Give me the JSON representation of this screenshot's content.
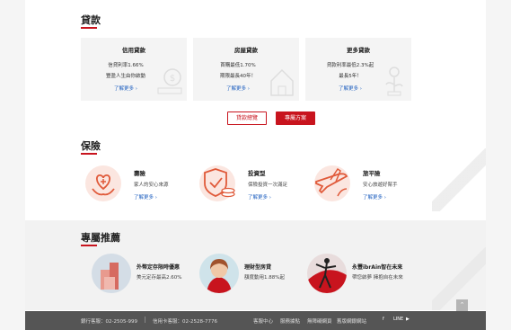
{
  "loan": {
    "title": "貸款",
    "cards": [
      {
        "title": "信用貸款",
        "line1": "信貸利率1.66%",
        "line2": "豐盈人生由你啟動",
        "more": "了解更多 ›"
      },
      {
        "title": "房屋貸款",
        "line1": "首購最低1.70%",
        "line2": "期限最長40年！",
        "more": "了解更多 ›"
      },
      {
        "title": "更多貸款",
        "line1": "貸款利率最低2.3%起",
        "line2": "最長5年！",
        "more": "了解更多 ›"
      }
    ],
    "btn_overview": "貸款總覽",
    "btn_exclusive": "專屬方案"
  },
  "insurance": {
    "title": "保險",
    "items": [
      {
        "title": "壽險",
        "sub": "家人的安心來源",
        "more": "了解更多 ›",
        "icon": "heart-hands-icon"
      },
      {
        "title": "投資型",
        "sub": "保險投資一次滿足",
        "more": "了解更多 ›",
        "icon": "shield-coins-icon"
      },
      {
        "title": "旅平險",
        "sub": "安心旅遊好幫手",
        "more": "了解更多 ›",
        "icon": "airplane-icon"
      }
    ]
  },
  "promo": {
    "title": "專屬推薦",
    "items": [
      {
        "title": "外幣定存限時優惠",
        "sub": "美元定存最高2.60%"
      },
      {
        "title": "理財型房貸",
        "sub": "額度動用1.88%起"
      },
      {
        "title": "永豐ibrAin智在未來",
        "sub": "帶您啟夢 擁抱自在未來"
      }
    ]
  },
  "footer": {
    "bank_service": "銀行客服：02-2505-999",
    "card_service": "信用卡客服：02-2528-7776",
    "links": [
      "客服中心",
      "服務據點",
      "無障礙網頁",
      "舊版網銀網站"
    ],
    "social": [
      "f",
      "LINE",
      "▶"
    ]
  },
  "colors": {
    "accent": "#c8141e",
    "link": "#2060c0",
    "footer_bg": "#555555"
  }
}
